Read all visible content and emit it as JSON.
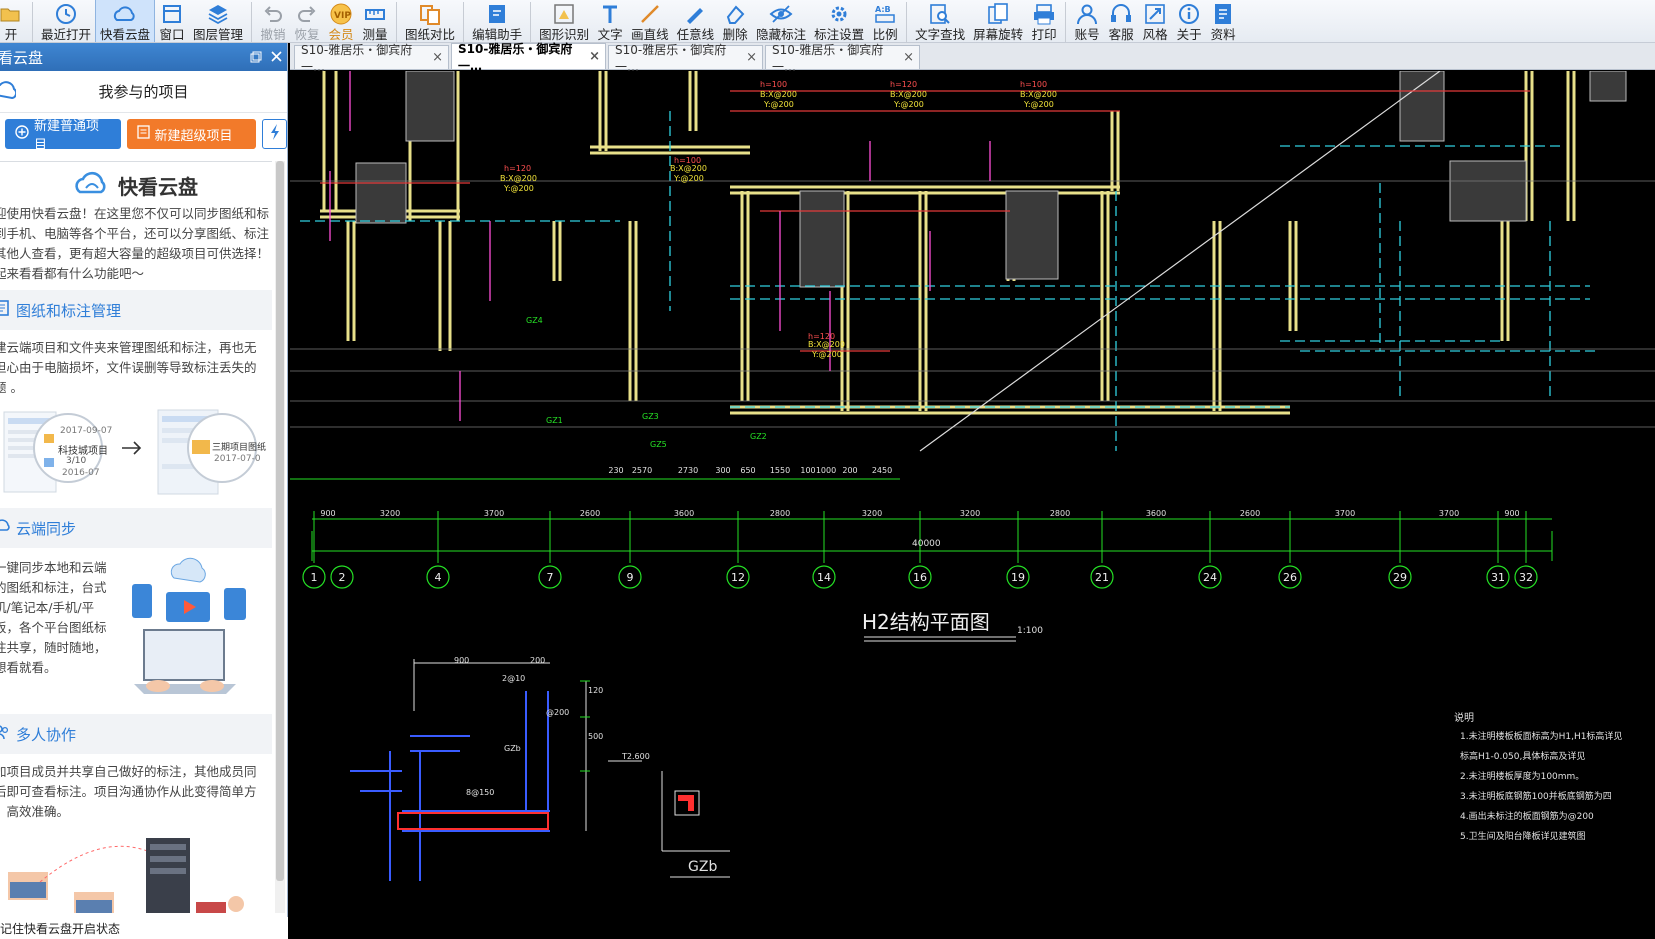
{
  "toolbar": {
    "items": [
      {
        "label": "开",
        "icon": "open-icon"
      },
      {
        "label": "最近打开",
        "icon": "recent-clock-icon"
      },
      {
        "label": "快看云盘",
        "icon": "cloud-icon"
      },
      {
        "label": "窗口",
        "icon": "window-icon"
      },
      {
        "label": "图层管理",
        "icon": "layers-icon"
      },
      {
        "label": "撤销",
        "icon": "undo-icon"
      },
      {
        "label": "恢复",
        "icon": "redo-icon"
      },
      {
        "label": "会员",
        "icon": "vip-icon"
      },
      {
        "label": "测量",
        "icon": "measure-icon"
      },
      {
        "label": "图纸对比",
        "icon": "compare-icon"
      },
      {
        "label": "编辑助手",
        "icon": "edit-assistant-icon"
      },
      {
        "label": "图形识别",
        "icon": "shape-recognize-icon"
      },
      {
        "label": "文字",
        "icon": "text-icon"
      },
      {
        "label": "画直线",
        "icon": "line-icon"
      },
      {
        "label": "任意线",
        "icon": "freehand-icon"
      },
      {
        "label": "删除",
        "icon": "eraser-icon"
      },
      {
        "label": "隐藏标注",
        "icon": "hide-eye-icon"
      },
      {
        "label": "标注设置",
        "icon": "settings-icon"
      },
      {
        "label": "比例",
        "icon": "scale-icon"
      },
      {
        "label": "文字查找",
        "icon": "find-text-icon"
      },
      {
        "label": "屏幕旋转",
        "icon": "rotate-icon"
      },
      {
        "label": "打印",
        "icon": "print-icon"
      },
      {
        "label": "账号",
        "icon": "account-icon"
      },
      {
        "label": "客服",
        "icon": "headset-icon"
      },
      {
        "label": "风格",
        "icon": "style-icon"
      },
      {
        "label": "关于",
        "icon": "about-icon"
      },
      {
        "label": "资料",
        "icon": "docs-icon"
      }
    ]
  },
  "panel": {
    "title": "看云盘",
    "project_header": "我参与的项目",
    "new_normal_project": "新建普通项目",
    "new_super_project": "新建超级项目",
    "intro_title": "快看云盘",
    "intro_text": [
      "迎使用快看云盘！在这里您不仅可以同步图纸和标",
      "到手机、电脑等各个平台，还可以分享图纸、标注",
      "其他人查看，更有超大容量的超级项目可供选择！",
      "起来看看都有什么功能吧～"
    ],
    "sections": [
      {
        "title": "图纸和标注管理",
        "text": [
          "建云端项目和文件夹来管理图纸和标注，再也无",
          "担心由于电脑损坏，文件误删等导致标注丢失的",
          "题 。"
        ]
      },
      {
        "title": "云端同步",
        "text": [
          "一键同步本地和云端",
          "的图纸和标注，台式",
          "机/笔记本/手机/平",
          "板，各个平台图纸标",
          "注共享，随时随地，",
          "想看就看。"
        ]
      },
      {
        "title": "多人协作",
        "text": [
          "加项目成员并共享自己做好的标注，其他成员同",
          "后即可查看标注。项目沟通协作从此变得简单方",
          "，高效准确。"
        ]
      }
    ],
    "illustration_labels": [
      "科技城项目",
      "3/10",
      "2016-07",
      "三期项目图纸",
      "2017-07-0",
      "2017-09-07"
    ],
    "status": "记住快看云盘开启状态"
  },
  "tabs": [
    {
      "label": "S10-雅居乐・御宾府一…",
      "active": false
    },
    {
      "label": "S10-雅居乐・御宾府一…",
      "active": true
    },
    {
      "label": "S10-雅居乐・御宾府一…",
      "active": false
    },
    {
      "label": "S10-雅居乐・御宾府一…",
      "active": false
    }
  ],
  "drawing": {
    "plan_title": "H2结构平面图",
    "plan_scale": "1:100",
    "total_dim": "40000",
    "axis_labels": [
      "1",
      "2",
      "4",
      "7",
      "9",
      "12",
      "14",
      "16",
      "19",
      "21",
      "24",
      "26",
      "29",
      "31",
      "32"
    ],
    "span_dims": [
      "900",
      "3200",
      "3700",
      "2600",
      "3600",
      "2800",
      "3200",
      "3200",
      "2800",
      "3600",
      "2600",
      "3700",
      "3700",
      "900"
    ],
    "upper_dims": [
      "230",
      "2570",
      "2730",
      "300",
      "650",
      "1550",
      "100",
      "1000",
      "200",
      "2450"
    ],
    "detail_title": "GZb",
    "detail_labels": [
      "900",
      "200",
      "GZb",
      "8@150",
      "@200",
      "T2.600",
      "2@10",
      "500",
      "120"
    ],
    "notes_title": "说明",
    "notes": [
      "1.未注明楼板板面标高为H1,H1标高详见",
      "   标高H1-0.050,具体标高及详见",
      "2.未注明楼板厚度为100mm。",
      "3.未注明板底钢筋100并板底钢筋为四",
      "4.画出未标注的板面钢筋为@200",
      "5.卫生间及阳台降板详见建筑图"
    ],
    "red_labels": [
      "h=100",
      "h=120",
      "h=100",
      "h=120",
      "h=100",
      "h=120"
    ],
    "green_labels": [
      "GZ3",
      "GZ2",
      "GZ1",
      "GZ4",
      "GZ5"
    ],
    "yellow_labels": [
      "B:X@200",
      "Y:@200"
    ]
  }
}
